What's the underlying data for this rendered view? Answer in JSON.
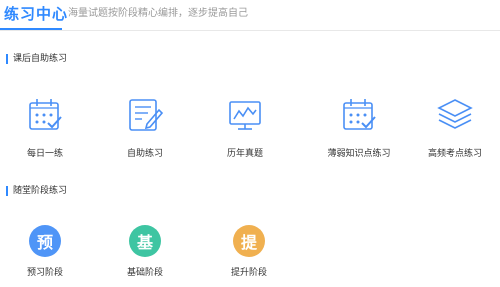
{
  "header": {
    "title": "练习中心",
    "subtitle": "海量试题按阶段精心编排，逐步提高自己"
  },
  "sections": [
    {
      "title": "课后自助练习",
      "items": [
        {
          "label": "每日一练",
          "icon": "calendar-check-icon"
        },
        {
          "label": "自助练习",
          "icon": "document-pen-icon"
        },
        {
          "label": "历年真题",
          "icon": "monitor-chart-icon"
        },
        {
          "label": "薄弱知识点练习",
          "icon": "calendar-check-icon"
        },
        {
          "label": "高频考点练习",
          "icon": "layers-icon"
        }
      ]
    },
    {
      "title": "随堂阶段练习",
      "items": [
        {
          "label": "预习阶段",
          "badge": "预",
          "color": "#4f95f7"
        },
        {
          "label": "基础阶段",
          "badge": "基",
          "color": "#3ec5a2"
        },
        {
          "label": "提升阶段",
          "badge": "提",
          "color": "#f0b050"
        }
      ]
    }
  ],
  "accent": "#2f89ff"
}
